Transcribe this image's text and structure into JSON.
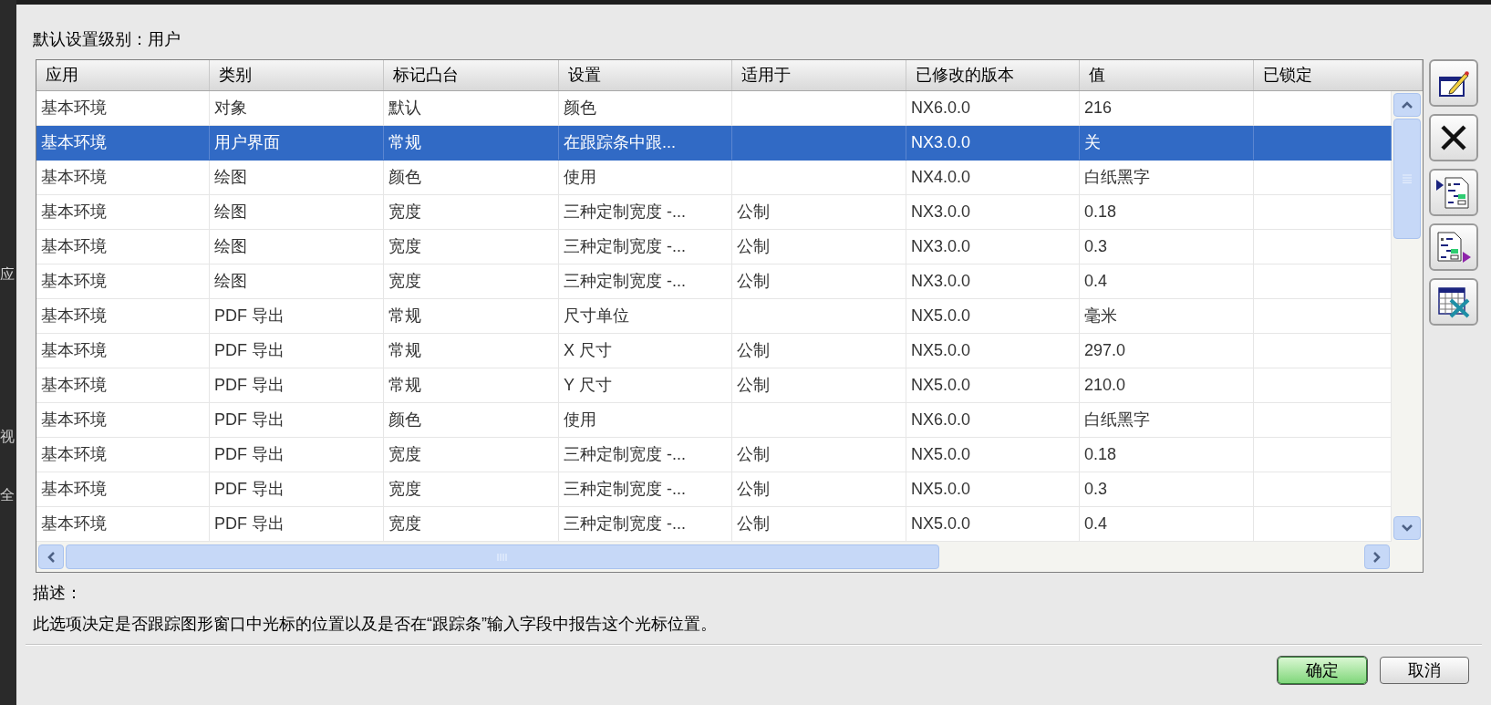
{
  "side_strip": {
    "items": [
      "应",
      "视",
      "全"
    ]
  },
  "level_label": "默认设置级别：用户",
  "table": {
    "columns": [
      "应用",
      "类别",
      "标记凸台",
      "设置",
      "适用于",
      "已修改的版本",
      "值",
      "已锁定"
    ],
    "rows": [
      {
        "cells": [
          "基本环境",
          "对象",
          "默认",
          "颜色",
          "",
          "NX6.0.0",
          "216",
          ""
        ],
        "selected": false
      },
      {
        "cells": [
          "基本环境",
          "用户界面",
          "常规",
          "在跟踪条中跟...",
          "",
          "NX3.0.0",
          "关",
          ""
        ],
        "selected": true
      },
      {
        "cells": [
          "基本环境",
          "绘图",
          "颜色",
          "使用",
          "",
          "NX4.0.0",
          "白纸黑字",
          ""
        ],
        "selected": false
      },
      {
        "cells": [
          "基本环境",
          "绘图",
          "宽度",
          "三种定制宽度 -...",
          "公制",
          "NX3.0.0",
          "0.18",
          ""
        ],
        "selected": false
      },
      {
        "cells": [
          "基本环境",
          "绘图",
          "宽度",
          "三种定制宽度 -...",
          "公制",
          "NX3.0.0",
          "0.3",
          ""
        ],
        "selected": false
      },
      {
        "cells": [
          "基本环境",
          "绘图",
          "宽度",
          "三种定制宽度 -...",
          "公制",
          "NX3.0.0",
          "0.4",
          ""
        ],
        "selected": false
      },
      {
        "cells": [
          "基本环境",
          "PDF 导出",
          "常规",
          "尺寸单位",
          "",
          "NX5.0.0",
          "毫米",
          ""
        ],
        "selected": false
      },
      {
        "cells": [
          "基本环境",
          "PDF 导出",
          "常规",
          "X 尺寸",
          "公制",
          "NX5.0.0",
          "297.0",
          ""
        ],
        "selected": false
      },
      {
        "cells": [
          "基本环境",
          "PDF 导出",
          "常规",
          "Y 尺寸",
          "公制",
          "NX5.0.0",
          "210.0",
          ""
        ],
        "selected": false
      },
      {
        "cells": [
          "基本环境",
          "PDF 导出",
          "颜色",
          "使用",
          "",
          "NX6.0.0",
          "白纸黑字",
          ""
        ],
        "selected": false
      },
      {
        "cells": [
          "基本环境",
          "PDF 导出",
          "宽度",
          "三种定制宽度 -...",
          "公制",
          "NX5.0.0",
          "0.18",
          ""
        ],
        "selected": false
      },
      {
        "cells": [
          "基本环境",
          "PDF 导出",
          "宽度",
          "三种定制宽度 -...",
          "公制",
          "NX5.0.0",
          "0.3",
          ""
        ],
        "selected": false
      },
      {
        "cells": [
          "基本环境",
          "PDF 导出",
          "宽度",
          "三种定制宽度 -...",
          "公制",
          "NX5.0.0",
          "0.4",
          ""
        ],
        "selected": false
      }
    ]
  },
  "side_tools": [
    {
      "kind": "edit"
    },
    {
      "kind": "delete"
    },
    {
      "kind": "import"
    },
    {
      "kind": "export"
    },
    {
      "kind": "spreadsheet"
    }
  ],
  "description": {
    "label": "描述：",
    "text": "此选项决定是否跟踪图形窗口中光标的位置以及是否在“跟踪条”输入字段中报告这个光标位置。"
  },
  "buttons": [
    {
      "label": "确定",
      "kind": "default"
    },
    {
      "label": "取消",
      "kind": "normal"
    }
  ]
}
